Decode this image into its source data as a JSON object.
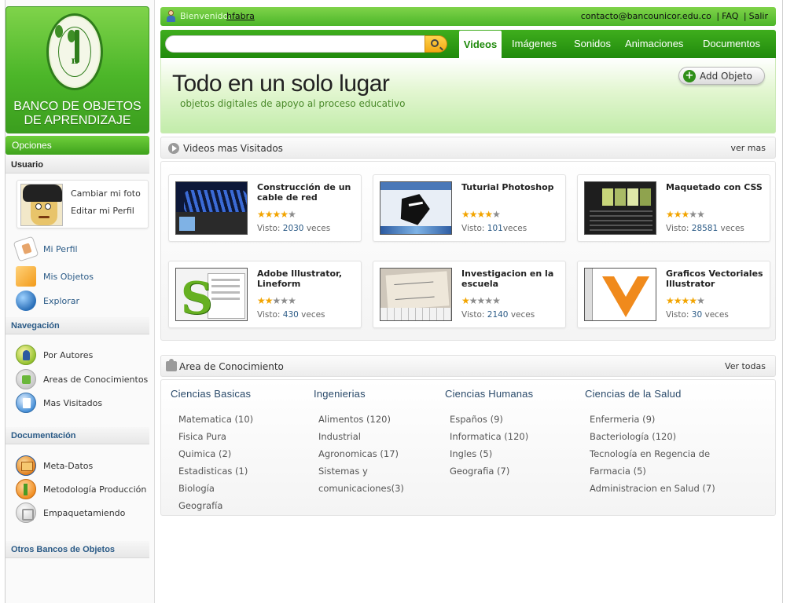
{
  "logo": {
    "title_line1": "BANCO DE OBJETOS",
    "title_line2": "DE APRENDIZAJE",
    "seal_symbol": "π",
    "seal_icon": "university-seal-icon"
  },
  "sidebar": {
    "opciones_label": "Opciones",
    "usuario": {
      "heading": "Usuario",
      "change_photo": "Cambiar mi foto",
      "edit_profile": "Editar mi Perfil",
      "items": [
        {
          "label": "Mi Perfil",
          "icon": "profile-card-icon"
        },
        {
          "label": "Mis Objetos",
          "icon": "box-icon"
        },
        {
          "label": "Explorar",
          "icon": "globe-icon"
        }
      ]
    },
    "navegacion": {
      "heading": "Navegación",
      "items": [
        {
          "label": "Por Autores",
          "icon": "user-icon"
        },
        {
          "label": "Areas de Conocimientos",
          "icon": "puzzle-icon"
        },
        {
          "label": "Mas Visitados",
          "icon": "document-icon"
        }
      ]
    },
    "documentacion": {
      "heading": "Documentación",
      "items": [
        {
          "label": "Meta-Datos",
          "icon": "metadata-icon"
        },
        {
          "label": "Metodología Producción",
          "icon": "methodology-icon"
        },
        {
          "label": "Empaquetamiendo",
          "icon": "package-icon"
        }
      ]
    },
    "otros": {
      "heading": "Otros Bancos de Objetos"
    }
  },
  "topbar": {
    "welcome": "Bienvenido:",
    "username": "hfabra",
    "email": "contacto@bancounicor.edu.co",
    "faq": "FAQ",
    "logout": "Salir",
    "separator": "|"
  },
  "search": {
    "value": "",
    "placeholder": ""
  },
  "tabs": [
    "Videos",
    "Imágenes",
    "Sonidos",
    "Animaciones",
    "Documentos"
  ],
  "active_tab": "Videos",
  "hero": {
    "title": "Todo en un solo lugar",
    "subtitle": "objetos digitales de apoyo al proceso educativo",
    "add_button": "Add Objeto"
  },
  "videos_section": {
    "title": "Videos mas Visitados",
    "more": "ver mas",
    "visto_prefix": "Visto:",
    "visto_suffix": "veces",
    "items": [
      {
        "title": "Construcción de un cable de red",
        "rating": 4,
        "views": "2030",
        "suffix": " veces"
      },
      {
        "title": "Tuturial Photoshop",
        "rating": 4,
        "views": "101",
        "suffix": "veces"
      },
      {
        "title": "Maquetado con CSS",
        "rating": 3,
        "views": "28581",
        "suffix": " veces"
      },
      {
        "title": "Adobe Illustrator, Lineform",
        "rating": 2,
        "views": "430",
        "suffix": " veces"
      },
      {
        "title": "Investigacion en la escuela",
        "rating": 1,
        "views": "2140",
        "suffix": " veces"
      },
      {
        "title": "Graficos Vectoriales Illustrator",
        "rating": 4,
        "views": "30",
        "suffix": " veces"
      }
    ]
  },
  "areas_section": {
    "title": "Area de Conocimiento",
    "more": "Ver todas",
    "columns": [
      {
        "heading": "Ciencias Basicas",
        "items": [
          "Matematica (10)",
          "Fisica Pura",
          "Quimica (2)",
          "Estadisticas (1)",
          "Biología",
          "Geografía"
        ]
      },
      {
        "heading": "Ingenierias",
        "items": [
          "Alimentos (120)",
          "Industrial",
          "Agronomicas (17)",
          "Sistemas y",
          "comunicaciones(3)"
        ]
      },
      {
        "heading": "Ciencias Humanas",
        "items": [
          "Españos (9)",
          "Informatica (120)",
          "Ingles (5)",
          "Geografia (7)"
        ]
      },
      {
        "heading": "Ciencias de la Salud",
        "items": [
          "Enfermeria (9)",
          "Bacteriología (120)",
          "Tecnología en Regencia de",
          "Farmacia (5)",
          "Administracion en Salud (7)"
        ]
      }
    ]
  },
  "colors": {
    "brand_green": "#4cb629",
    "dark_green": "#208a0c",
    "star_gold": "#f2a400",
    "link_blue": "#2a5a86"
  }
}
